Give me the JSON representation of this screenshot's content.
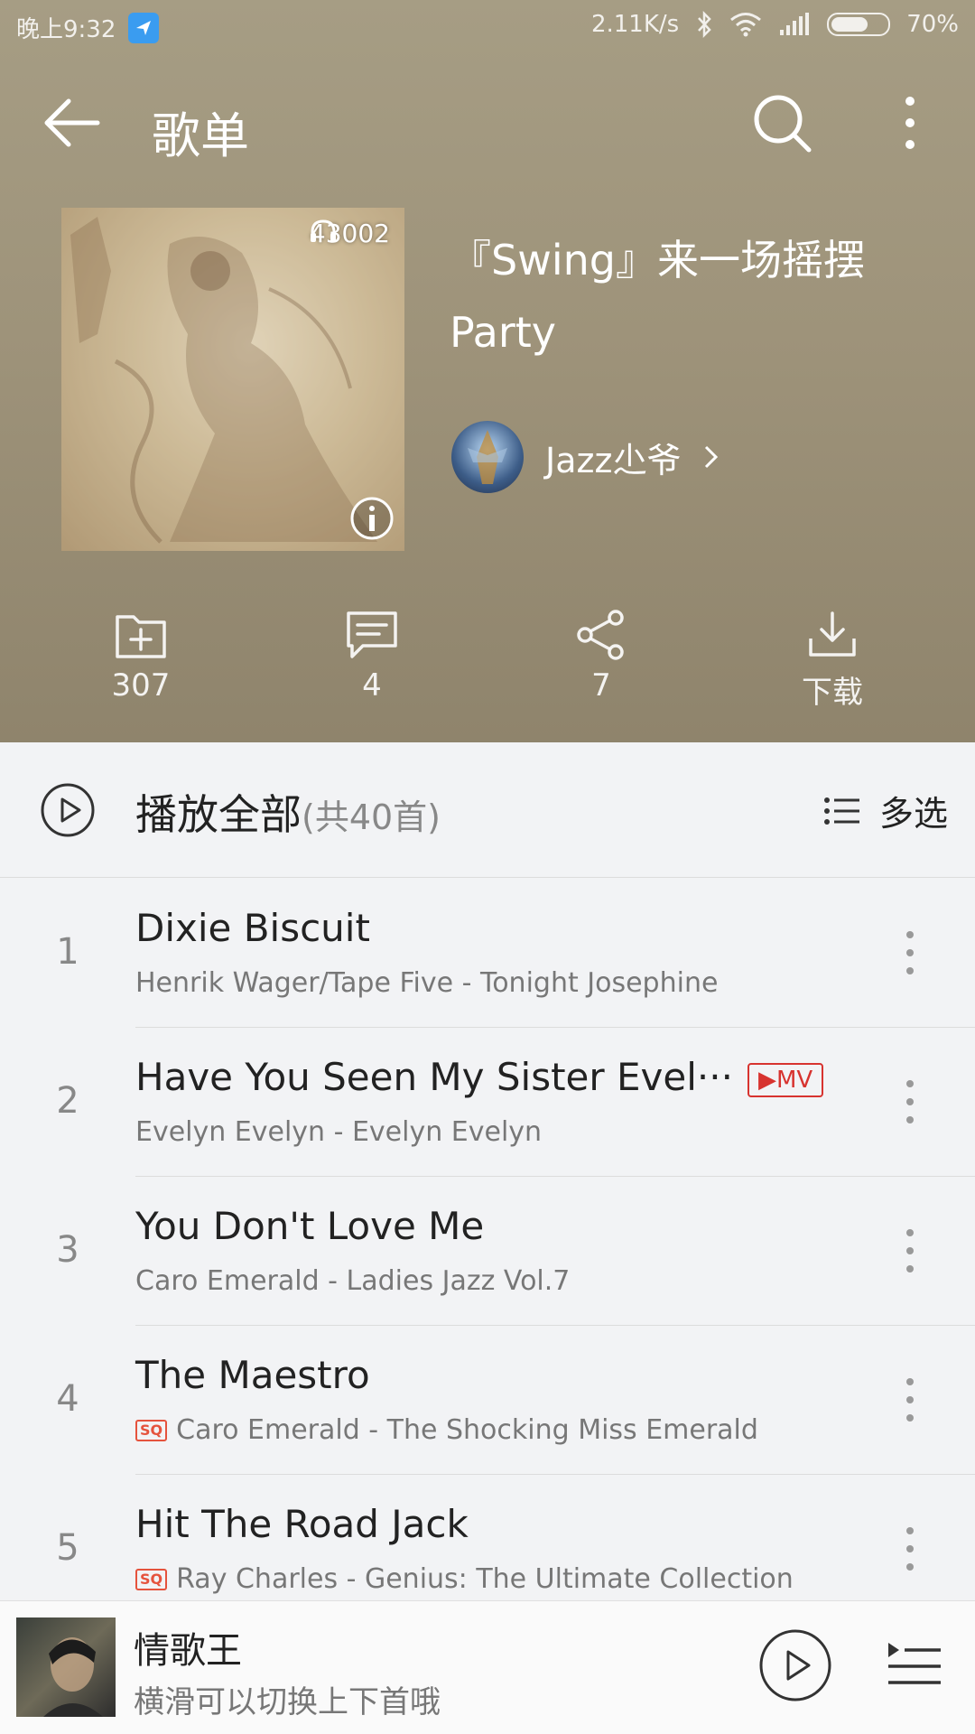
{
  "status_bar": {
    "time": "晚上9:32",
    "network_speed": "2.11K/s",
    "battery": "70%",
    "battery_level": 0.7
  },
  "topbar": {
    "title": "歌单"
  },
  "playlist": {
    "play_count": "43002",
    "title": "『Swing』来一场摇摆Party",
    "creator_name": "Jazz尐爷"
  },
  "actions": [
    {
      "name": "collect",
      "label": "307"
    },
    {
      "name": "comment",
      "label": "4"
    },
    {
      "name": "share",
      "label": "7"
    },
    {
      "name": "download",
      "label": "下载"
    }
  ],
  "play_all": {
    "label": "播放全部",
    "count": "(共40首)",
    "multi_select": "多选"
  },
  "songs": [
    {
      "index": "1",
      "title": "Dixie Biscuit",
      "subtitle": "Henrik Wager/Tape Five - Tonight Josephine",
      "sq": false,
      "mv": ""
    },
    {
      "index": "2",
      "title": "Have You Seen My Sister Evel···",
      "subtitle": "Evelyn Evelyn - Evelyn Evelyn",
      "sq": false,
      "mv": "▶MV"
    },
    {
      "index": "3",
      "title": "You Don't Love Me",
      "subtitle": "Caro Emerald - Ladies Jazz Vol.7",
      "sq": false,
      "mv": ""
    },
    {
      "index": "4",
      "title": "The Maestro",
      "subtitle": "Caro Emerald - The Shocking Miss Emerald",
      "sq": true,
      "mv": ""
    },
    {
      "index": "5",
      "title": "Hit The Road Jack",
      "subtitle": "Ray Charles - Genius: The Ultimate Collection",
      "sq": true,
      "mv": ""
    }
  ],
  "sq_badge": "SQ",
  "mini_player": {
    "title": "情歌王",
    "subtitle": "横滑可以切换上下首哦"
  },
  "colors": {
    "header_bg": "#9e937a",
    "accent_red": "#d7332f",
    "sq_orange": "#e5533d"
  }
}
